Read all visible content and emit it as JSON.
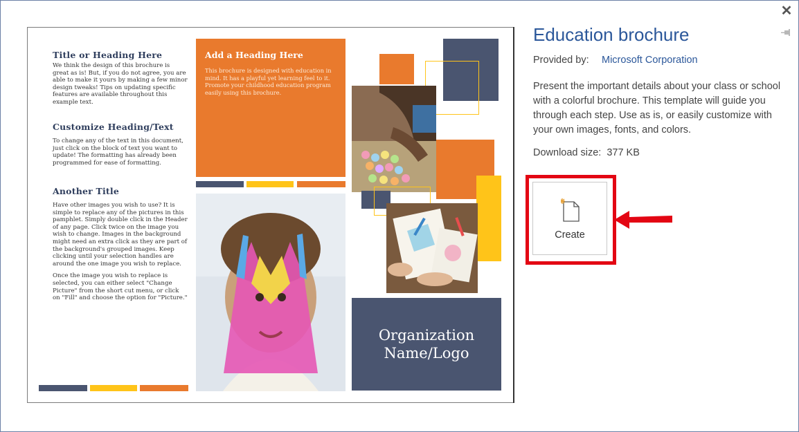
{
  "window": {
    "close_icon": "close-icon",
    "pin_icon": "pin-icon"
  },
  "brochure": {
    "col1": [
      {
        "heading": "Title or Heading Here",
        "body": "We think the design of this brochure is great as is!  But, if you do not agree, you are able to make it yours by making a few minor design tweaks!  Tips on updating specific features are available throughout this example text."
      },
      {
        "heading": "Customize Heading/Text",
        "body": "To change any of the text in this document, just click on the block of text you want to update!  The formatting has already been programmed for ease of formatting."
      },
      {
        "heading": "Another Title",
        "body": "Have other images you wish to use?  It is simple to replace any of the pictures in this pamphlet.  Simply double click in the Header of any page.  Click twice on the image you wish to change.  Images in the background might need an extra click as they are part of the background's grouped images.  Keep clicking until your selection handles are around the one image you wish to replace.",
        "body2": "Once the image you wish to replace is selected, you can either select \"Change Picture\" from the short cut menu, or click on \"Fill\" and choose the option for \"Picture.\""
      }
    ],
    "col2": {
      "heading": "Add a Heading Here",
      "body": "This brochure is designed with education in mind.  It has a playful yet learning feel to it.  Promote your childhood education program easily using this brochure."
    },
    "org": {
      "line1": "Organization",
      "line2": "Name/Logo"
    },
    "colors": {
      "navy": "#4a5570",
      "orange": "#e97a2d",
      "yellow": "#ffc419"
    }
  },
  "details": {
    "title": "Education brochure",
    "provided_label": "Provided by:",
    "provider": "Microsoft Corporation",
    "description": "Present the important details about your class or school with a colorful brochure. This template will guide you through each step. Use as is, or easily customize with your own images, fonts, and colors.",
    "download_label": "Download size:",
    "download_value": "377 KB"
  },
  "create": {
    "label": "Create",
    "icon": "new-document-icon"
  },
  "annotation": {
    "highlight_color": "#e30613",
    "arrow_icon": "red-arrow-icon"
  }
}
